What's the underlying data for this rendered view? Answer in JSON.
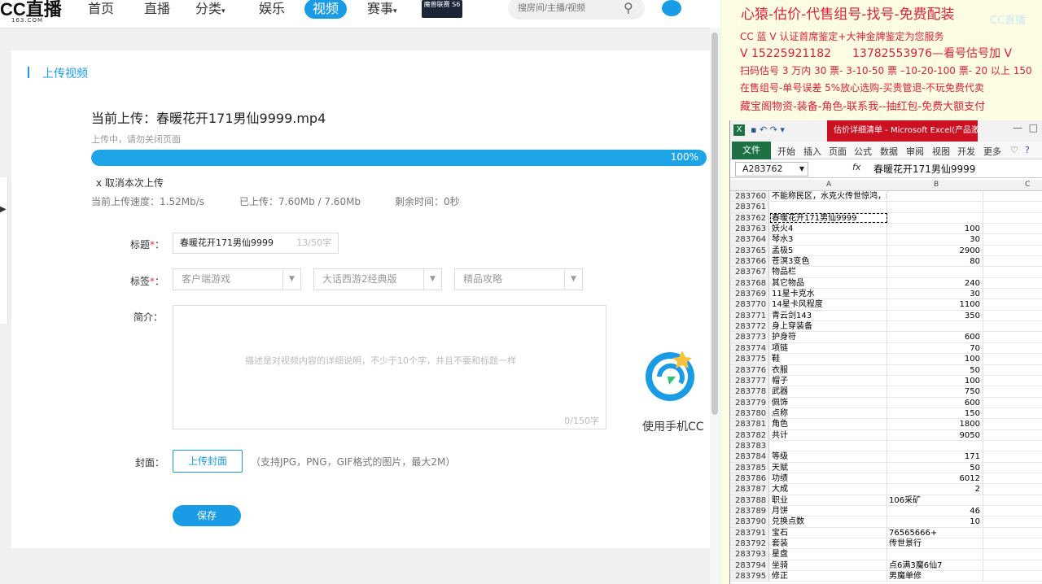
{
  "nav": {
    "logo": "CC直播",
    "logo_sub": "163.COM",
    "items": [
      "首页",
      "直播",
      "分类",
      "娱乐",
      "视频",
      "赛事"
    ],
    "badge": "魔兽联赛 S6",
    "search_placeholder": "搜房间/主播/视频",
    "accent": "#1a9be6"
  },
  "upload": {
    "section_title": "上传视频",
    "current": "当前上传：春暖花开171男仙9999.mp4",
    "status": "上传中，请勿关闭页面",
    "progress": 100,
    "progress_text": "100%",
    "cancel": "x 取消本次上传",
    "speed": "当前上传速度：1.52Mb/s",
    "uploaded": "已上传：7.60Mb / 7.60Mb",
    "remaining": "剩余时间：0秒"
  },
  "form": {
    "title_label": "标题",
    "title_value": "春暖花开171男仙9999",
    "title_count": "13/50字",
    "tags_label": "标签",
    "tags": [
      "客户端游戏",
      "大话西游2经典版",
      "精品攻略"
    ],
    "intro_label": "简介：",
    "intro_placeholder": "描述是对视频内容的详细说明，不少于10个字，并且不要和标题一样",
    "intro_count": "0/150字",
    "cover_label": "封面：",
    "cover_button": "上传封面",
    "cover_hint": "（支持JPG，PNG，GIF格式的图片，最大2M）",
    "save_button": "保存"
  },
  "mascot_text": "使用手机CC",
  "overlay": {
    "title": "心猿-估价-代售组号-找号-免费配装",
    "watermark": "CC直播",
    "line1": "CC 蓝 V 认证首席鉴定+大神金牌鉴定为您服务",
    "line2_a": "V 15225921182",
    "line2_b": "13782553976—看号估号加 V",
    "line3": "扫码估号 3 万内 30 票- 3-10-50 票 –10-20-100 票- 20 以上 150",
    "line4": "在售组号-单号误差 5%放心选购-买贵管退-不玩免费代卖",
    "line5": "藏宝阁物资-装备-角色-联系我--抽红包-免费大额支付"
  },
  "excel": {
    "window_title": "估价详细清单 - Microsoft Excel(产品激活失败)",
    "tabs": [
      "开始",
      "插入",
      "页面",
      "公式",
      "数据",
      "审阅",
      "视图",
      "开发",
      "更多"
    ],
    "file_tab": "文件",
    "name_box": "A283762",
    "fx": "fx",
    "formula": "春暖花开171男仙9999",
    "columns": [
      "A",
      "B",
      "C"
    ],
    "rows": [
      [
        "283760",
        "不能称民区，水克火传世惊鸿，装备宝宝齐全",
        ""
      ],
      [
        "283761",
        "",
        ""
      ],
      [
        "283762",
        "春暖花开171男仙9999",
        ""
      ],
      [
        "283763",
        "妖火4",
        "100"
      ],
      [
        "283764",
        "琴水3",
        "30"
      ],
      [
        "283765",
        "孟极5",
        "2900"
      ],
      [
        "283766",
        "苍溟3变色",
        "80"
      ],
      [
        "283767",
        "物品栏",
        ""
      ],
      [
        "283768",
        "其它物品",
        "240"
      ],
      [
        "283769",
        "11星卡克水",
        "30"
      ],
      [
        "283770",
        "14星卡风程度",
        "1100"
      ],
      [
        "283771",
        "青云剑143",
        "350"
      ],
      [
        "283772",
        "身上穿装备",
        ""
      ],
      [
        "283773",
        "护身符",
        "600"
      ],
      [
        "283774",
        "项链",
        "70"
      ],
      [
        "283775",
        "鞋",
        "100"
      ],
      [
        "283776",
        "衣服",
        "50"
      ],
      [
        "283777",
        "帽子",
        "100"
      ],
      [
        "283778",
        "武器",
        "750"
      ],
      [
        "283779",
        "佩饰",
        "600"
      ],
      [
        "283780",
        "点称",
        "150"
      ],
      [
        "283781",
        "角色",
        "1800"
      ],
      [
        "283782",
        "共计",
        "9050"
      ],
      [
        "283783",
        "",
        ""
      ],
      [
        "283784",
        "等级",
        "171"
      ],
      [
        "283785",
        "天赋",
        "50"
      ],
      [
        "283786",
        "功绩",
        "6012"
      ],
      [
        "283787",
        "大成",
        "2"
      ],
      [
        "283788",
        "职业",
        "106采矿"
      ],
      [
        "283789",
        "月饼",
        "46"
      ],
      [
        "283790",
        "兑换点数",
        "10"
      ],
      [
        "283791",
        "宝石",
        "76565666+"
      ],
      [
        "283792",
        "套装",
        "传世景行"
      ],
      [
        "283793",
        "星盘",
        ""
      ],
      [
        "283794",
        "坐骑",
        "点6满3魔6仙7"
      ],
      [
        "283795",
        "修正",
        "男魔单修"
      ]
    ]
  }
}
